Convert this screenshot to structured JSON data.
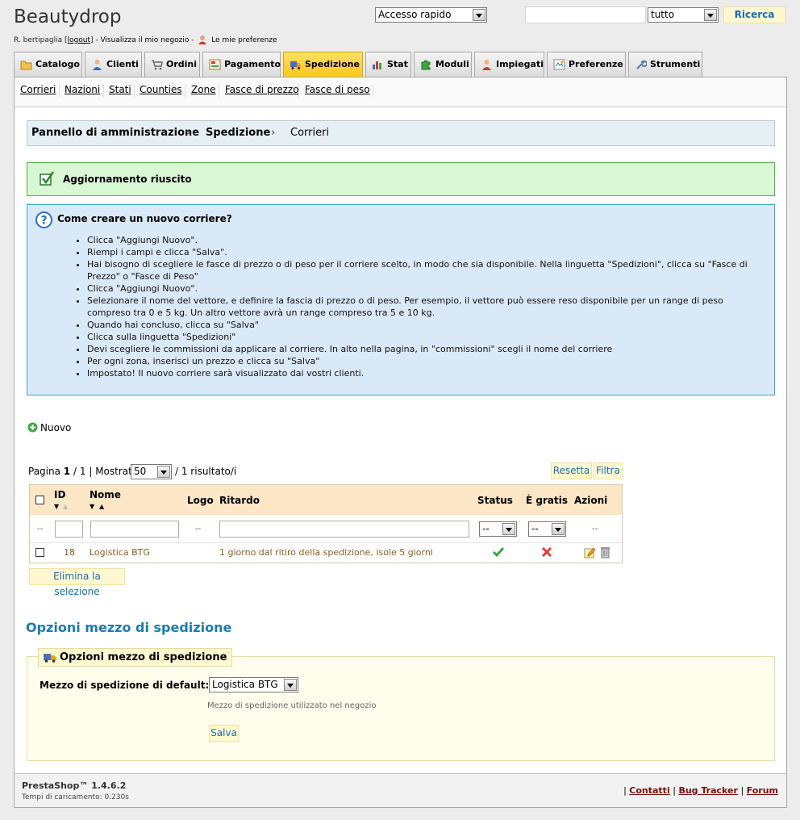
{
  "header": {
    "shop_name": "Beautydrop",
    "user_name": "R. bertipaglia",
    "user_bracket_open": "[",
    "logout": "logout",
    "user_bracket_close": "]",
    "view_shop": "- Visualizza il mio negozio -",
    "preferences": "Le mie preferenze",
    "quick_access": "Accesso rapido",
    "search_value": "",
    "search_scope": "tutto",
    "search_button": "Ricerca"
  },
  "tabs": [
    {
      "label": "Catalogo",
      "icon": "folder-icon"
    },
    {
      "label": "Clienti",
      "icon": "customer-icon"
    },
    {
      "label": "Ordini",
      "icon": "cart-icon"
    },
    {
      "label": "Pagamento",
      "icon": "payment-icon"
    },
    {
      "label": "Spedizione",
      "icon": "truck-icon",
      "active": true
    },
    {
      "label": "Stat",
      "icon": "chart-icon"
    },
    {
      "label": "Moduli",
      "icon": "puzzle-icon"
    },
    {
      "label": "Impiegati",
      "icon": "employee-icon"
    },
    {
      "label": "Preferenze",
      "icon": "preferences-icon"
    },
    {
      "label": "Strumenti",
      "icon": "wrench-icon"
    }
  ],
  "subnav": [
    "Corrieri",
    "Nazioni",
    "Stati",
    "Counties",
    "Zone",
    "Fasce di prezzo",
    "Fasce di peso"
  ],
  "breadcrumb": {
    "root": "Pannello di amministrazione",
    "section": "Spedizione",
    "current": "Corrieri",
    "separator": "›"
  },
  "success_message": "Aggiornamento riuscito",
  "hint": {
    "title": "Come creare un nuovo corriere?",
    "items": [
      "Clicca \"Aggiungi Nuovo\".",
      "Riempi i campi e clicca \"Salva\".",
      "Hai bisogno di scegliere le fasce di prezzo o di peso per il corriere scelto, in modo che sia disponibile. Nella linguetta \"Spedizioni\", clicca su \"Fasce di Prezzo\" o \"Fasce di Peso\"",
      "Clicca \"Aggiungi Nuovo\".",
      "Selezionare il nome del vettore, e definire la fascia di prezzo o di peso. Per esempio, il vettore può essere reso disponibile per un range di peso compreso tra 0 e 5 kg. Un altro vettore avrà un range compreso tra 5 e 10 kg.",
      "Quando hai concluso, clicca su \"Salva\"",
      "Clicca sulla linguetta \"Spedizioni\"",
      "Devi scegliere le commissioni da applicare al corriere. In alto nella pagina, in \"commissioni\" scegli il nome del corriere",
      "Per ogni zona, inserisci un prezzo e clicca su \"Salva\"",
      "Impostato! Il nuovo corriere sarà visualizzato dai vostri clienti."
    ]
  },
  "new_label": "Nuovo",
  "pagination": {
    "page_label": "Pagina",
    "page": "1",
    "slash_total": "/ 1",
    "separator": "|",
    "shown_label": "Mostrata",
    "per_page": "50",
    "results": "/ 1 risultato/i",
    "reset": "Resetta",
    "filter": "Filtra"
  },
  "table": {
    "columns": {
      "id": "ID",
      "name": "Nome",
      "logo": "Logo",
      "delay": "Ritardo",
      "status": "Status",
      "free": "È gratis",
      "actions": "Azioni"
    },
    "filter_placeholder": "--",
    "filter_select": "--",
    "rows": [
      {
        "id": "18",
        "name": "Logistica BTG",
        "delay": "1 giorno dal ritiro della spedizione, isole 5 giorni",
        "status": "enabled",
        "free": "no"
      }
    ]
  },
  "delete_selection": "Elimina la selezione",
  "shipping_options": {
    "section_title": "Opzioni mezzo di spedizione",
    "legend": "Opzioni mezzo di spedizione",
    "default_label": "Mezzo di spedizione di default:",
    "default_value": "Logistica BTG",
    "help": "Mezzo di spedizione utilizzato nel negozio",
    "save": "Salva"
  },
  "footer": {
    "version": "PrestaShop™ 1.4.6.2",
    "load_time": "Tempi di caricamento: 0.230s",
    "separator": "|",
    "contacts": "Contatti",
    "bug_tracker": "Bug Tracker",
    "forum": "Forum"
  },
  "colors": {
    "accent": "#1c7cae",
    "active_tab": "#ffc81a",
    "success_bg": "#d9f7d5",
    "hint_bg": "#d9e9f8",
    "grid_header": "#fbe6c5"
  }
}
